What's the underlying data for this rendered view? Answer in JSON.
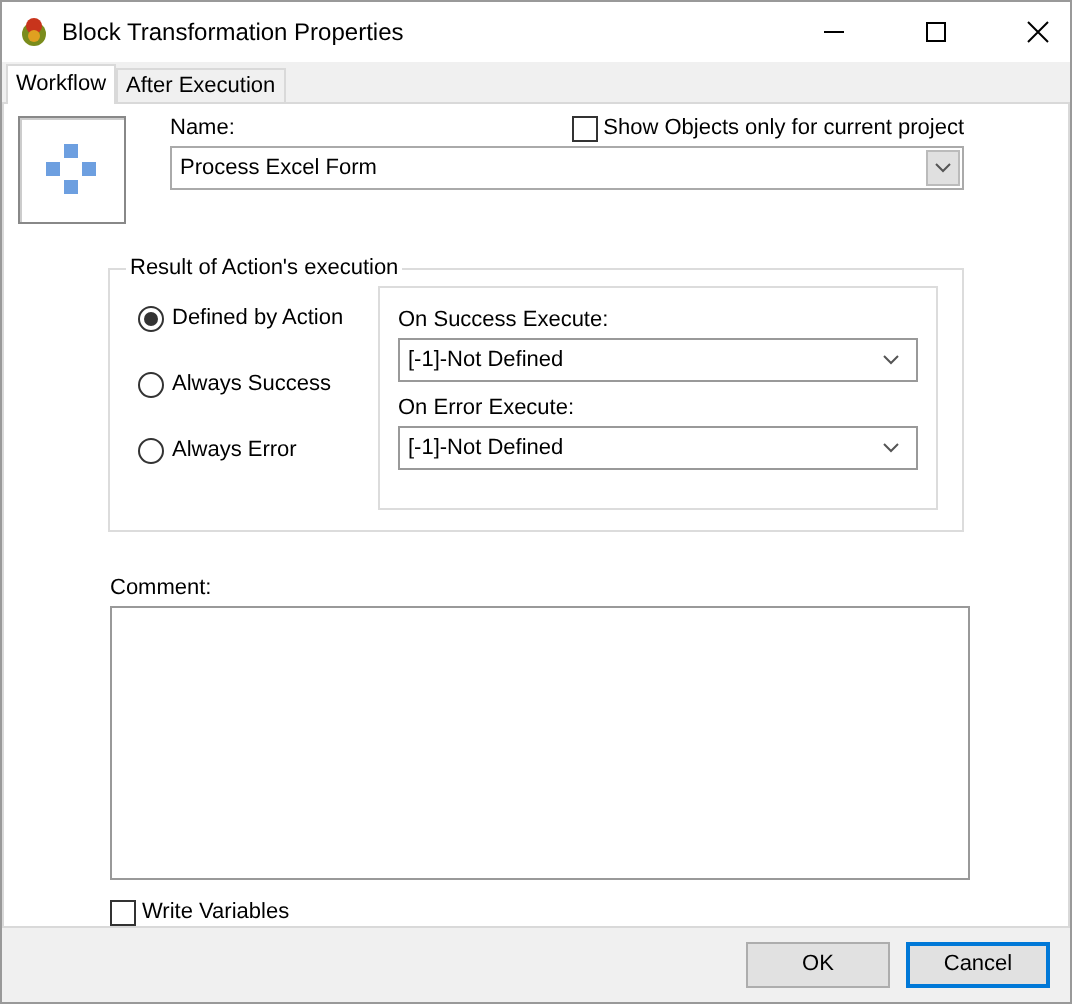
{
  "window": {
    "title": "Block Transformation Properties"
  },
  "tabs": [
    {
      "label": "Workflow",
      "selected": true
    },
    {
      "label": "After Execution",
      "selected": false
    }
  ],
  "name_field": {
    "label": "Name:",
    "value": "Process Excel Form"
  },
  "show_objects": {
    "label": "Show Objects only for current project",
    "checked": false
  },
  "result_group": {
    "title": "Result of Action's execution",
    "options": [
      {
        "label": "Defined by  Action",
        "selected": true
      },
      {
        "label": "Always Success",
        "selected": false
      },
      {
        "label": "Always Error",
        "selected": false
      }
    ],
    "on_success": {
      "label": "On Success Execute:",
      "value": "[-1]-Not Defined"
    },
    "on_error": {
      "label": "On Error Execute:",
      "value": "[-1]-Not Defined"
    }
  },
  "comment": {
    "label": "Comment:"
  },
  "write_variables": {
    "label": "Write Variables",
    "checked": false
  },
  "buttons": [
    {
      "label": "OK",
      "focused": false
    },
    {
      "label": "Cancel",
      "focused": true
    }
  ]
}
